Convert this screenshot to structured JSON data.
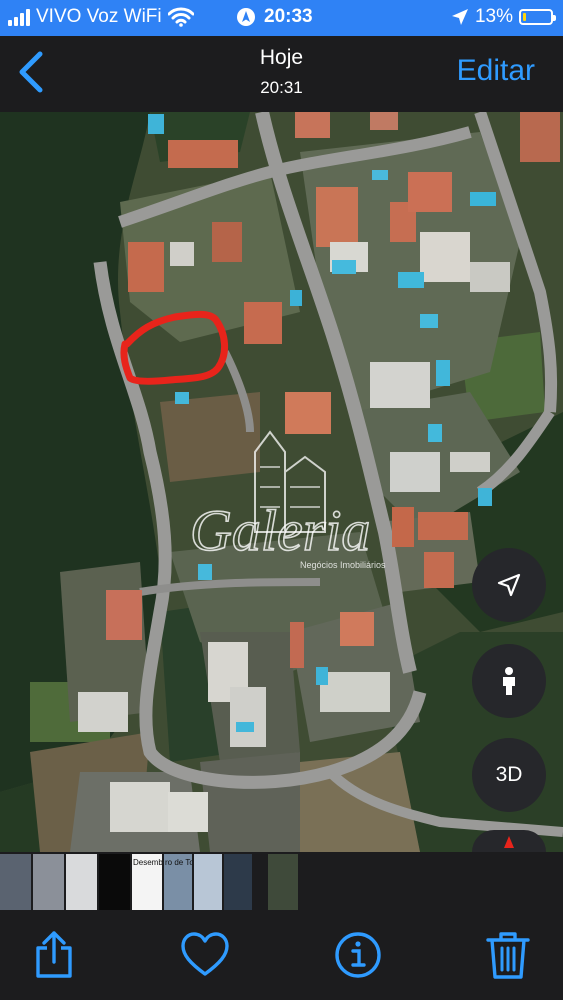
{
  "status": {
    "carrier": "VIVO Voz WiFi",
    "time": "20:33",
    "battery_percent": "13%",
    "battery_level": 0.13
  },
  "nav": {
    "back_icon": "chevron-left-icon",
    "title": "Hoje",
    "subtitle": "20:31",
    "edit_label": "Editar"
  },
  "photo": {
    "watermark_text": "Galeria",
    "watermark_tagline": "Negócios Imobiliários"
  },
  "map_controls": {
    "locate_icon": "location-arrow-icon",
    "person_icon": "person-icon",
    "threed_label": "3D",
    "compass_icon": "compass-icon"
  },
  "filmstrip": {
    "thumbs": [
      {
        "color": "#5a6370"
      },
      {
        "color": "#8b9099"
      },
      {
        "color": "#d9dadc"
      },
      {
        "color": "#0a0a0a"
      },
      {
        "color": "#f4f4f4",
        "text": "Desemba"
      },
      {
        "color": "#7a8fa6",
        "text": "ro de Tole"
      },
      {
        "color": "#b8c6d6"
      },
      {
        "color": "#2d3a4a"
      },
      {
        "color": "#3f4a3a"
      },
      {
        "color": "#4a5560"
      }
    ]
  },
  "toolbar": {
    "share_icon": "share-icon",
    "favorite_icon": "heart-icon",
    "info_icon": "info-icon",
    "delete_icon": "trash-icon",
    "accent": "#2f9bff"
  }
}
